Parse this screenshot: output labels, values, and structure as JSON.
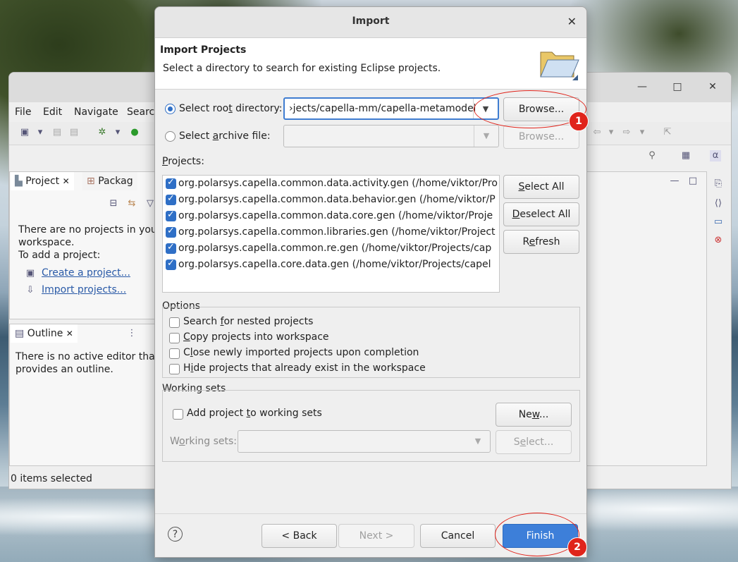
{
  "eclipse": {
    "menu": [
      "File",
      "Edit",
      "Navigate",
      "Search"
    ],
    "project_tab": "Project",
    "package_tab": "Packag",
    "no_projects_text_1": "There are no projects in your",
    "no_projects_text_2": "workspace.",
    "no_projects_text_3": "To add a project:",
    "create_link": "Create a project...",
    "import_link": "Import projects...",
    "outline_tab": "Outline",
    "outline_text_1": "There is no active editor that",
    "outline_text_2": "provides an outline.",
    "status": "0 items selected"
  },
  "dialog": {
    "title": "Import",
    "close": "✕",
    "header_title": "Import Projects",
    "header_subtitle": "Select a directory to search for existing Eclipse projects.",
    "root_dir_label": "Select root directory:",
    "root_dir_value": "›jects/capella-mm/capella-metamodel",
    "archive_label": "Select archive file:",
    "archive_value": "",
    "browse_label": "Browse...",
    "browse2_label": "Browse...",
    "projects_label": "Projects:",
    "projects": [
      "org.polarsys.capella.common.data.activity.gen (/home/viktor/Pro",
      "org.polarsys.capella.common.data.behavior.gen (/home/viktor/P",
      "org.polarsys.capella.common.data.core.gen (/home/viktor/Proje",
      "org.polarsys.capella.common.libraries.gen (/home/viktor/Project",
      "org.polarsys.capella.common.re.gen (/home/viktor/Projects/cap",
      "org.polarsys.capella.core.data.gen (/home/viktor/Projects/capel"
    ],
    "select_all": "Select All",
    "deselect_all": "Deselect All",
    "refresh": "Refresh",
    "options_label": "Options",
    "options": [
      "Search for nested projects",
      "Copy projects into workspace",
      "Close newly imported projects upon completion",
      "Hide projects that already exist in the workspace"
    ],
    "working_sets_label": "Working sets",
    "add_to_ws": "Add project to working sets",
    "new_btn": "New...",
    "ws_field_label": "Working sets:",
    "select_btn": "Select...",
    "back": "< Back",
    "next": "Next >",
    "cancel": "Cancel",
    "finish": "Finish",
    "help": "?"
  },
  "annotations": {
    "badge1": "1",
    "badge2": "2",
    "color": "#e0241b"
  },
  "accent": "#3d7fd9"
}
